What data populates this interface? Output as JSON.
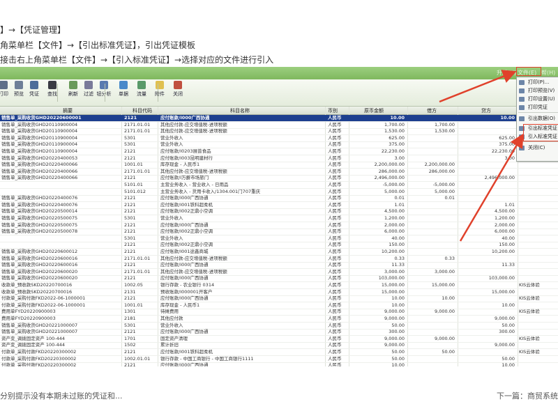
{
  "instructions": [
    "】→【凭证管理】",
    "角菜单栏【文件】→【引出标准凭证】，引出凭证模板",
    "接击右上角菜单栏【文件】→【引入标准凭证】→选择对应的文件进行引入"
  ],
  "titlebar": {
    "items": [
      "升级(U)",
      "文件(E)",
      "帮(H)"
    ]
  },
  "toolbar": {
    "buttons": [
      {
        "label": "打印",
        "icon": "print-icon",
        "color": "#5f6f88"
      },
      {
        "label": "预览",
        "icon": "preview-icon",
        "color": "#6f7f98"
      },
      {
        "label": "凭证",
        "icon": "voucher-icon",
        "color": "#4d6d9a"
      },
      {
        "label": "查找",
        "icon": "binoculars-icon",
        "color": "#3a3a44"
      },
      {
        "label": "刷新",
        "icon": "refresh-icon",
        "color": "#6a9a5a"
      },
      {
        "label": "过滤",
        "icon": "filter-icon",
        "color": "#7a7a9a"
      },
      {
        "label": "钮分析",
        "icon": "analysis-icon",
        "color": "#5a7ab0"
      },
      {
        "label": "单据",
        "icon": "document-icon",
        "color": "#4a8aca"
      },
      {
        "label": "流量",
        "icon": "flow-icon",
        "color": "#5a9a6a"
      },
      {
        "label": "附件",
        "icon": "attachment-icon",
        "color": "#e0c050"
      },
      {
        "label": "关闭",
        "icon": "close-door-icon",
        "color": "#c05040"
      }
    ]
  },
  "grid": {
    "headers": [
      "摘要",
      "科目代码",
      "科目名称",
      "币别",
      "原币金额",
      "借方",
      "贷方"
    ],
    "rows": [
      {
        "summary": "销售单_采购收货GHD20220600001",
        "code": "2121",
        "name": "应付账款/I000广西协通",
        "cur": "人民币",
        "amt": "10.00",
        "debit": "",
        "credit": "10.00",
        "extra": "",
        "selected": true
      },
      {
        "summary": "销售单_采购收货GHD20110900004",
        "code": "2171.01.01",
        "name": "其他应付款-应交增值税-进项税额",
        "cur": "人民币",
        "amt": "1,700.00",
        "debit": "1,700.00",
        "credit": "",
        "extra": ""
      },
      {
        "summary": "销售单_采购收货GHD20110900004",
        "code": "2171.01.01",
        "name": "其他应付款-应交增值税-进项税额",
        "cur": "人民币",
        "amt": "1,530.00",
        "debit": "1,530.00",
        "credit": "",
        "extra": ""
      },
      {
        "summary": "销售单_采购收货GHD20110900004",
        "code": "5301",
        "name": "营业外收入",
        "cur": "人民币",
        "amt": "625.00",
        "debit": "",
        "credit": "625.00",
        "extra": ""
      },
      {
        "summary": "销售单_采购收货GHD20110900004",
        "code": "5301",
        "name": "营业外收入",
        "cur": "人民币",
        "amt": "375.00",
        "debit": "",
        "credit": "375.00",
        "extra": ""
      },
      {
        "summary": "销售单_采购收货GHD20110900004",
        "code": "2121",
        "name": "应付账款/I0203展普食品",
        "cur": "人民币",
        "amt": "22,230.00",
        "debit": "",
        "credit": "22,230.00",
        "extra": ""
      },
      {
        "summary": "销售单_采购收货GHD20220400053",
        "code": "2121",
        "name": "应付账款/I003昆明建材行",
        "cur": "人民币",
        "amt": "3.00",
        "debit": "",
        "credit": "3.00",
        "extra": ""
      },
      {
        "summary": "销售单_采购收货GHD20220400066",
        "code": "1001.01",
        "name": "库存现金 - 人民币1",
        "cur": "人民币",
        "amt": "2,200,000.00",
        "debit": "2,200,000.00",
        "credit": "",
        "extra": ""
      },
      {
        "summary": "销售单_采购收货GHD20220400066",
        "code": "2171.01.01",
        "name": "其他应付款-应交增值税-进项税额",
        "cur": "人民币",
        "amt": "286,000.00",
        "debit": "286,000.00",
        "credit": "",
        "extra": ""
      },
      {
        "summary": "销售单_采购收货GHD20220400066",
        "code": "2121",
        "name": "应付账款/I万爵市场旅门",
        "cur": "人民币",
        "amt": "2,496,000.00",
        "debit": "",
        "credit": "2,496,000.00",
        "extra": ""
      },
      {
        "summary": "",
        "code": "5101.01",
        "name": "主营业务收入 - 营业收入 - 日用品",
        "cur": "人民币",
        "amt": "-5,000.00",
        "debit": "-5,000.00",
        "credit": "",
        "extra": ""
      },
      {
        "summary": "",
        "code": "5101.012",
        "name": "主营业务收入 - 货用卡收入/1304.001门707重庆",
        "cur": "人民币",
        "amt": "5,000.00",
        "debit": "5,000.00",
        "credit": "",
        "extra": ""
      },
      {
        "summary": "销售单_采购收货GHD20220400076",
        "code": "2121",
        "name": "应付账款/I000广西协通",
        "cur": "人民币",
        "amt": "0.01",
        "debit": "0.01",
        "credit": "",
        "extra": ""
      },
      {
        "summary": "销售单_采购收货GHD20220400076",
        "code": "2121",
        "name": "应付账款/I001铁科超柔机",
        "cur": "人民币",
        "amt": "1.01",
        "debit": "",
        "credit": "1.01",
        "extra": ""
      },
      {
        "summary": "销售单_采购收货GHD20220500014",
        "code": "2121",
        "name": "应付账款/I002正鼎小空调",
        "cur": "人民币",
        "amt": "4,500.00",
        "debit": "",
        "credit": "4,500.00",
        "extra": ""
      },
      {
        "summary": "销售单_采购收货GHD20220500075",
        "code": "5301",
        "name": "营业外收入",
        "cur": "人民币",
        "amt": "1,200.00",
        "debit": "",
        "credit": "1,200.00",
        "extra": ""
      },
      {
        "summary": "销售单_采购收货GHD20220500075",
        "code": "2121",
        "name": "应付账款/I000广西协通",
        "cur": "人民币",
        "amt": "2,000.00",
        "debit": "",
        "credit": "2,000.00",
        "extra": ""
      },
      {
        "summary": "销售单_采购收货GHD20220500078",
        "code": "2121",
        "name": "应付账款/I002正鼎小空调",
        "cur": "人民币",
        "amt": "6,000.00",
        "debit": "",
        "credit": "6,000.00",
        "extra": ""
      },
      {
        "summary": "",
        "code": "5301",
        "name": "营业外收入",
        "cur": "人民币",
        "amt": "40.00",
        "debit": "",
        "credit": "40.00",
        "extra": ""
      },
      {
        "summary": "",
        "code": "2121",
        "name": "应付账款/I002正鼎小空调",
        "cur": "人民币",
        "amt": "150.00",
        "debit": "",
        "credit": "150.00",
        "extra": ""
      },
      {
        "summary": "销售单_采购收货GHD20220600012",
        "code": "2121",
        "name": "应付账款/I001途鑫商城",
        "cur": "人民币",
        "amt": "10,200.00",
        "debit": "",
        "credit": "10,200.00",
        "extra": ""
      },
      {
        "summary": "销售单_采购收货GHD20220600016",
        "code": "2171.01.01",
        "name": "其他应付款-应交增值税-进项税额",
        "cur": "人民币",
        "amt": "0.33",
        "debit": "0.33",
        "credit": "",
        "extra": ""
      },
      {
        "summary": "销售单_采购收货GHD20220600016",
        "code": "2121",
        "name": "应付账款/I000广西协通",
        "cur": "人民币",
        "amt": "11.33",
        "debit": "",
        "credit": "11.33",
        "extra": ""
      },
      {
        "summary": "销售单_采购收货GHD20220600020",
        "code": "2171.01.01",
        "name": "其他应付款-应交增值税-进项税额",
        "cur": "人民币",
        "amt": "3,000.00",
        "debit": "3,000.00",
        "credit": "",
        "extra": ""
      },
      {
        "summary": "销售单_采购收货GHD20220600020",
        "code": "2121",
        "name": "应付账款/I000广西协通",
        "cur": "人民币",
        "amt": "103,000.00",
        "debit": "",
        "credit": "103,000.00",
        "extra": ""
      },
      {
        "summary": "收款单_预收款SKD20220700016",
        "code": "1002.05",
        "name": "银行存款 - 农业银行 0314",
        "cur": "人民币",
        "amt": "15,000.00",
        "debit": "15,000.00",
        "credit": "",
        "extra": "KIS云体验"
      },
      {
        "summary": "收款单_预收款SKD20220700016",
        "code": "2131",
        "name": "预收账款/I000001开客户",
        "cur": "人民币",
        "amt": "15,000.00",
        "debit": "",
        "credit": "15,000.00",
        "extra": ""
      },
      {
        "summary": "付款单_采购付款FKD2022-06-1000001",
        "code": "2121",
        "name": "应付账款/I000广西协通",
        "cur": "人民币",
        "amt": "10.00",
        "debit": "10.00",
        "credit": "",
        "extra": "KIS云体验"
      },
      {
        "summary": "付款单_采购付款FKD2022-06-1000001",
        "code": "1001.01",
        "name": "库存现金 - 人民币1",
        "cur": "人民币",
        "amt": "10.00",
        "debit": "",
        "credit": "10.00",
        "extra": ""
      },
      {
        "summary": "费用单FYD20220900003",
        "code": "1301",
        "name": "待摊费用",
        "cur": "人民币",
        "amt": "9,000.00",
        "debit": "9,000.00",
        "credit": "",
        "extra": "KIS云体验"
      },
      {
        "summary": "费用单FYD20220900003",
        "code": "2181",
        "name": "其他应付款",
        "cur": "人民币",
        "amt": "9,000.00",
        "debit": "",
        "credit": "9,000.00",
        "extra": ""
      },
      {
        "summary": "销售单_采购收货GHD20221000007",
        "code": "5301",
        "name": "营业外收入",
        "cur": "人民币",
        "amt": "50.00",
        "debit": "",
        "credit": "50.00",
        "extra": ""
      },
      {
        "summary": "销售单_采购收货GHD20221000007",
        "code": "2121",
        "name": "应付账款/I000广西协通",
        "cur": "人民币",
        "amt": "300.00",
        "debit": "",
        "credit": "300.00",
        "extra": ""
      },
      {
        "summary": "资产变_调拨固定资产 100-444",
        "code": "1701",
        "name": "固定资产清理",
        "cur": "人民币",
        "amt": "9,000.00",
        "debit": "9,000.00",
        "credit": "",
        "extra": "KIS云体验"
      },
      {
        "summary": "资产变_调拨固定资产 100-444",
        "code": "1502",
        "name": "累计折旧",
        "cur": "人民币",
        "amt": "9,000.00",
        "debit": "",
        "credit": "9,000.00",
        "extra": ""
      },
      {
        "summary": "付款单_采购付款FKD20220300002",
        "code": "2121",
        "name": "应付账款/I001铁科超柔机",
        "cur": "人民币",
        "amt": "50.00",
        "debit": "50.00",
        "credit": "",
        "extra": "KIS云体验"
      },
      {
        "summary": "付款单_采购付款FKD20220300002",
        "code": "1002.01.01",
        "name": "银行存款 - 中国工商银行 - 中国工商银行1111",
        "cur": "人民币",
        "amt": "50.00",
        "debit": "",
        "credit": "50.00",
        "extra": ""
      },
      {
        "summary": "付款单_采购付款FKD20220300002",
        "code": "2121",
        "name": "应付账款/I000广西协通",
        "cur": "人民币",
        "amt": "10.00",
        "debit": "",
        "credit": "10.00",
        "extra": ""
      },
      {
        "summary": "付款单_采购付款FKD20220300002",
        "code": "1001.01",
        "name": "库存现金 - 人民币1",
        "cur": "人民币",
        "amt": "10.00",
        "debit": "",
        "credit": "10.00",
        "extra": ""
      }
    ]
  },
  "file_menu": {
    "items": [
      {
        "label": "打印(P)...",
        "icon": "print-icon"
      },
      {
        "label": "打印预览(V)",
        "icon": "preview-icon"
      },
      {
        "label": "打印设置(U)",
        "icon": "print-settings-icon"
      },
      {
        "label": "打印凭证",
        "icon": "print-voucher-icon"
      },
      {
        "label": "引出数据(O)",
        "icon": "export-data-icon"
      },
      {
        "label": "引出标准凭证",
        "icon": "export-voucher-icon"
      },
      {
        "label": "引入标准凭证",
        "icon": "import-voucher-icon"
      },
      {
        "label": "关闭(C)",
        "icon": "close-icon"
      }
    ]
  },
  "footer": {
    "prev": "分别提示没有本期未过账的凭证和...",
    "next": "下一篇：商贸系统"
  },
  "colors": {
    "accent_red": "#e0412b",
    "titlebar_green": "#7fb85e",
    "selected_row": "#1d3f8f"
  }
}
